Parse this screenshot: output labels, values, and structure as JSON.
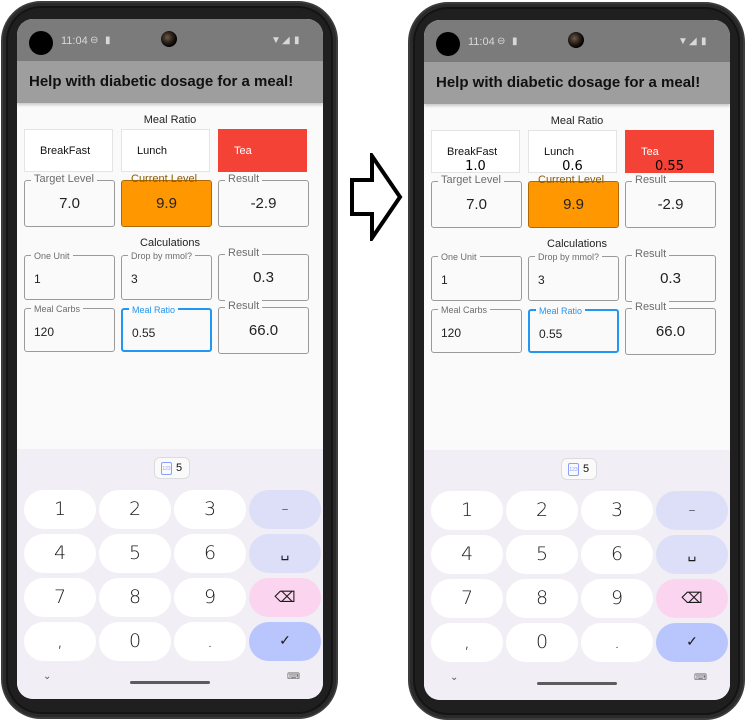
{
  "arrow_icon": "right-arrow-outline",
  "phones": [
    {
      "id": "before",
      "status": {
        "time": "11:04",
        "icons": [
          "steering-wheel-icon",
          "sim-card-icon",
          "wifi-icon",
          "signal-icon",
          "battery-icon"
        ]
      },
      "app_title": "Help with diabetic dosage for a meal!",
      "meal_ratio_title": "Meal Ratio",
      "meals": [
        {
          "label": "BreakFast",
          "ratio": "",
          "active": false
        },
        {
          "label": "Lunch",
          "ratio": "",
          "active": false
        },
        {
          "label": "Tea",
          "ratio": "",
          "active": true
        }
      ],
      "levels": [
        {
          "label": "Target Level",
          "value": "7.0"
        },
        {
          "label": "Current Level",
          "value": "9.9"
        },
        {
          "label": "Result",
          "value": "-2.9"
        }
      ],
      "calculations_title": "Calculations",
      "calc_row1": [
        {
          "label": "One Unit",
          "value": "1"
        },
        {
          "label": "Drop by mmol?",
          "value": "3"
        },
        {
          "label": "Result",
          "value": "0.3"
        }
      ],
      "calc_row2": [
        {
          "label": "Meal Carbs",
          "value": "120"
        },
        {
          "label": "Meal Ratio",
          "value": "0.55"
        },
        {
          "label": "Result",
          "value": "66.0"
        }
      ],
      "keyboard": {
        "clipboard_count": "5",
        "clipboard_icon_text": "123",
        "keys": [
          [
            "1",
            "2",
            "3",
            "–"
          ],
          [
            "4",
            "5",
            "6",
            "␣"
          ],
          [
            "7",
            "8",
            "9",
            "⌫"
          ],
          [
            ",",
            "0",
            ".",
            "✓"
          ]
        ],
        "colors": {
          "func": "#dcdff7",
          "delete": "#fbd5ef",
          "ok": "#b9c5fd"
        }
      }
    },
    {
      "id": "after",
      "status": {
        "time": "11:04",
        "icons": [
          "steering-wheel-icon",
          "sim-card-icon",
          "wifi-icon",
          "signal-icon",
          "battery-icon"
        ]
      },
      "app_title": "Help with diabetic dosage for a meal!",
      "meal_ratio_title": "Meal Ratio",
      "meals": [
        {
          "label": "BreakFast",
          "ratio": "1.0",
          "active": false
        },
        {
          "label": "Lunch",
          "ratio": "0.6",
          "active": false
        },
        {
          "label": "Tea",
          "ratio": "0.55",
          "active": true
        }
      ],
      "levels": [
        {
          "label": "Target Level",
          "value": "7.0"
        },
        {
          "label": "Current Level",
          "value": "9.9"
        },
        {
          "label": "Result",
          "value": "-2.9"
        }
      ],
      "calculations_title": "Calculations",
      "calc_row1": [
        {
          "label": "One Unit",
          "value": "1"
        },
        {
          "label": "Drop by mmol?",
          "value": "3"
        },
        {
          "label": "Result",
          "value": "0.3"
        }
      ],
      "calc_row2": [
        {
          "label": "Meal Carbs",
          "value": "120"
        },
        {
          "label": "Meal Ratio",
          "value": "0.55"
        },
        {
          "label": "Result",
          "value": "66.0"
        }
      ],
      "keyboard": {
        "clipboard_count": "5",
        "clipboard_icon_text": "123",
        "keys": [
          [
            "1",
            "2",
            "3",
            "–"
          ],
          [
            "4",
            "5",
            "6",
            "␣"
          ],
          [
            "7",
            "8",
            "9",
            "⌫"
          ],
          [
            ",",
            "0",
            ".",
            "✓"
          ]
        ],
        "colors": {
          "func": "#dcdff7",
          "delete": "#fbd5ef",
          "ok": "#b9c5fd"
        }
      }
    }
  ],
  "colors": {
    "active_meal": "#f44336",
    "current_level": "#ff9800",
    "focus": "#2196f3",
    "appbar": "#9e9e9e",
    "statusbar": "#7b7b7b"
  }
}
